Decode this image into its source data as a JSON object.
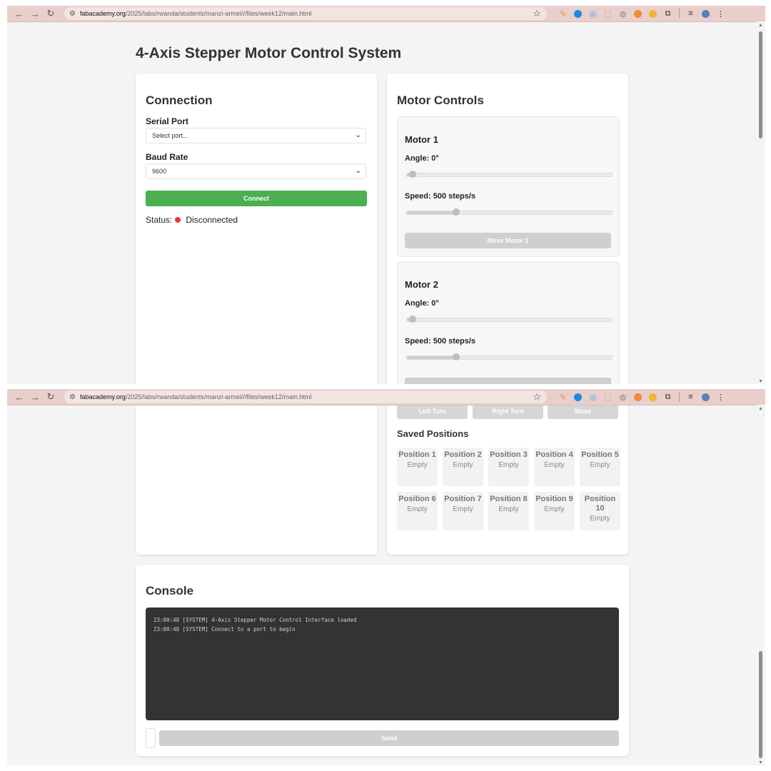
{
  "browser": {
    "url_host": "fabacademy.org",
    "url_path": "/2025/labs/rwanda/students/manzi-armel///files/week12/main.html"
  },
  "page": {
    "title": "4-Axis Stepper Motor Control System"
  },
  "connection": {
    "heading": "Connection",
    "serial_port_label": "Serial Port",
    "serial_port_value": "Select port...",
    "baud_rate_label": "Baud Rate",
    "baud_rate_value": "9600",
    "connect_label": "Connect",
    "status_label": "Status:",
    "status_value": "Disconnected",
    "status_color": "#e53935"
  },
  "motor_controls": {
    "heading": "Motor Controls",
    "motors": [
      {
        "name": "Motor 1",
        "angle_label": "Angle: 0°",
        "angle_fraction": 0.0,
        "speed_label": "Speed: 500 steps/s",
        "speed_fraction": 0.24,
        "button_label": "Move Motor 1"
      },
      {
        "name": "Motor 2",
        "angle_label": "Angle: 0°",
        "angle_fraction": 0.0,
        "speed_label": "Speed: 500 steps/s",
        "speed_fraction": 0.24
      }
    ]
  },
  "patterns": {
    "buttons": [
      "Left Turn",
      "Right Turn",
      "Wave"
    ]
  },
  "saved_positions": {
    "heading": "Saved Positions",
    "items": [
      {
        "name": "Position 1",
        "status": "Empty"
      },
      {
        "name": "Position 2",
        "status": "Empty"
      },
      {
        "name": "Position 3",
        "status": "Empty"
      },
      {
        "name": "Position 4",
        "status": "Empty"
      },
      {
        "name": "Position 5",
        "status": "Empty"
      },
      {
        "name": "Position 6",
        "status": "Empty"
      },
      {
        "name": "Position 7",
        "status": "Empty"
      },
      {
        "name": "Position 8",
        "status": "Empty"
      },
      {
        "name": "Position 9",
        "status": "Empty"
      },
      {
        "name": "Position 10",
        "status": "Empty"
      }
    ]
  },
  "console": {
    "heading": "Console",
    "lines": [
      "23:00:48 [SYSTEM] 4-Axis Stepper Motor Control Interface loaded",
      "23:00:48 [SYSTEM] Connect to a port to begin"
    ],
    "send_label": "Send"
  },
  "colors": {
    "accent_green": "#4caf50",
    "disabled_gray": "#cfcfcf",
    "console_bg": "#333333",
    "browser_bar": "#e8cfcc"
  }
}
